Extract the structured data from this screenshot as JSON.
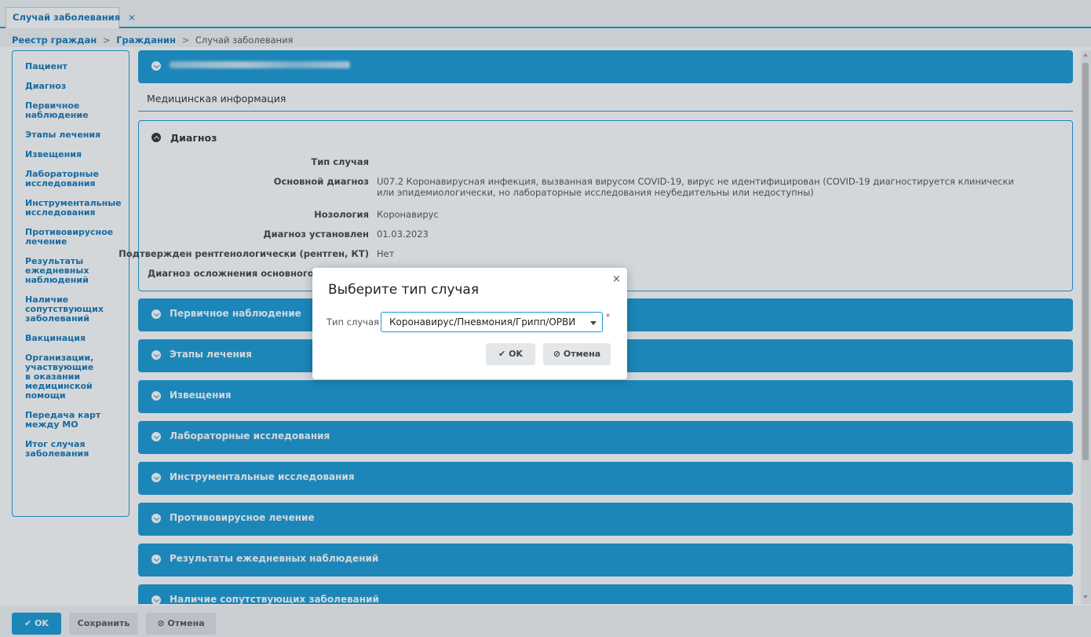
{
  "tab": {
    "title": "Случай заболевания",
    "close": "×"
  },
  "breadcrumb": {
    "items": [
      "Реестр граждан",
      "Гражданин",
      "Случай заболевания"
    ],
    "separator": ">"
  },
  "sidebar": {
    "items": [
      {
        "label": "Пациент"
      },
      {
        "label": "Диагноз"
      },
      {
        "label": "Первичное наблюдение"
      },
      {
        "label": "Этапы лечения"
      },
      {
        "label": "Извещения"
      },
      {
        "label": "Лабораторные исследования"
      },
      {
        "label": "Инструментальные исследования"
      },
      {
        "label": "Противовирусное лечение"
      },
      {
        "label": "Результаты ежедневных наблюдений"
      },
      {
        "label": "Наличие сопутствующих заболеваний"
      },
      {
        "label": "Вакцинация"
      },
      {
        "label": "Организации, участвующие в оказании медицинской помощи"
      },
      {
        "label": "Передача карт между МО"
      },
      {
        "label": "Итог случая заболевания"
      }
    ]
  },
  "main": {
    "med_info_title": "Медицинская информация",
    "diagnosis": {
      "title": "Диагноз",
      "fields": [
        {
          "label": "Тип случая",
          "value": ""
        },
        {
          "label": "Основной диагноз",
          "value": "U07.2 Коронавирусная инфекция, вызванная вирусом COVID-19, вирус не идентифицирован (COVID-19 диагностируется клинически или эпидемиологически, но лабораторные исследования неубедительны или недоступны)"
        },
        {
          "label": "Нозология",
          "value": "Коронавирус"
        },
        {
          "label": "Диагноз установлен",
          "value": "01.03.2023"
        },
        {
          "label": "Подтвержден рентгенологически (рентген, КТ)",
          "value": "Нет"
        },
        {
          "label": "Диагноз осложнения основного з",
          "value": ""
        }
      ]
    },
    "sections": [
      {
        "label": "Первичное наблюдение"
      },
      {
        "label": "Этапы лечения"
      },
      {
        "label": "Извещения"
      },
      {
        "label": "Лабораторные исследования"
      },
      {
        "label": "Инструментальные исследования"
      },
      {
        "label": "Противовирусное лечение"
      },
      {
        "label": "Результаты ежедневных наблюдений"
      },
      {
        "label": "Наличие сопутствующих заболеваний"
      }
    ]
  },
  "footer": {
    "ok": "✔ OK",
    "save": "Сохранить",
    "cancel": "⊘ Отмена"
  },
  "modal": {
    "title": "Выберите тип случая",
    "close": "×",
    "field_label": "Тип случая",
    "selected_value": "Коронавирус/Пневмония/Грипп/ОРВИ",
    "required_mark": "*",
    "ok": "✔ OK",
    "cancel": "⊘ Отмена"
  },
  "colors": {
    "accent": "#1a9ad6",
    "link": "#1577b8"
  }
}
